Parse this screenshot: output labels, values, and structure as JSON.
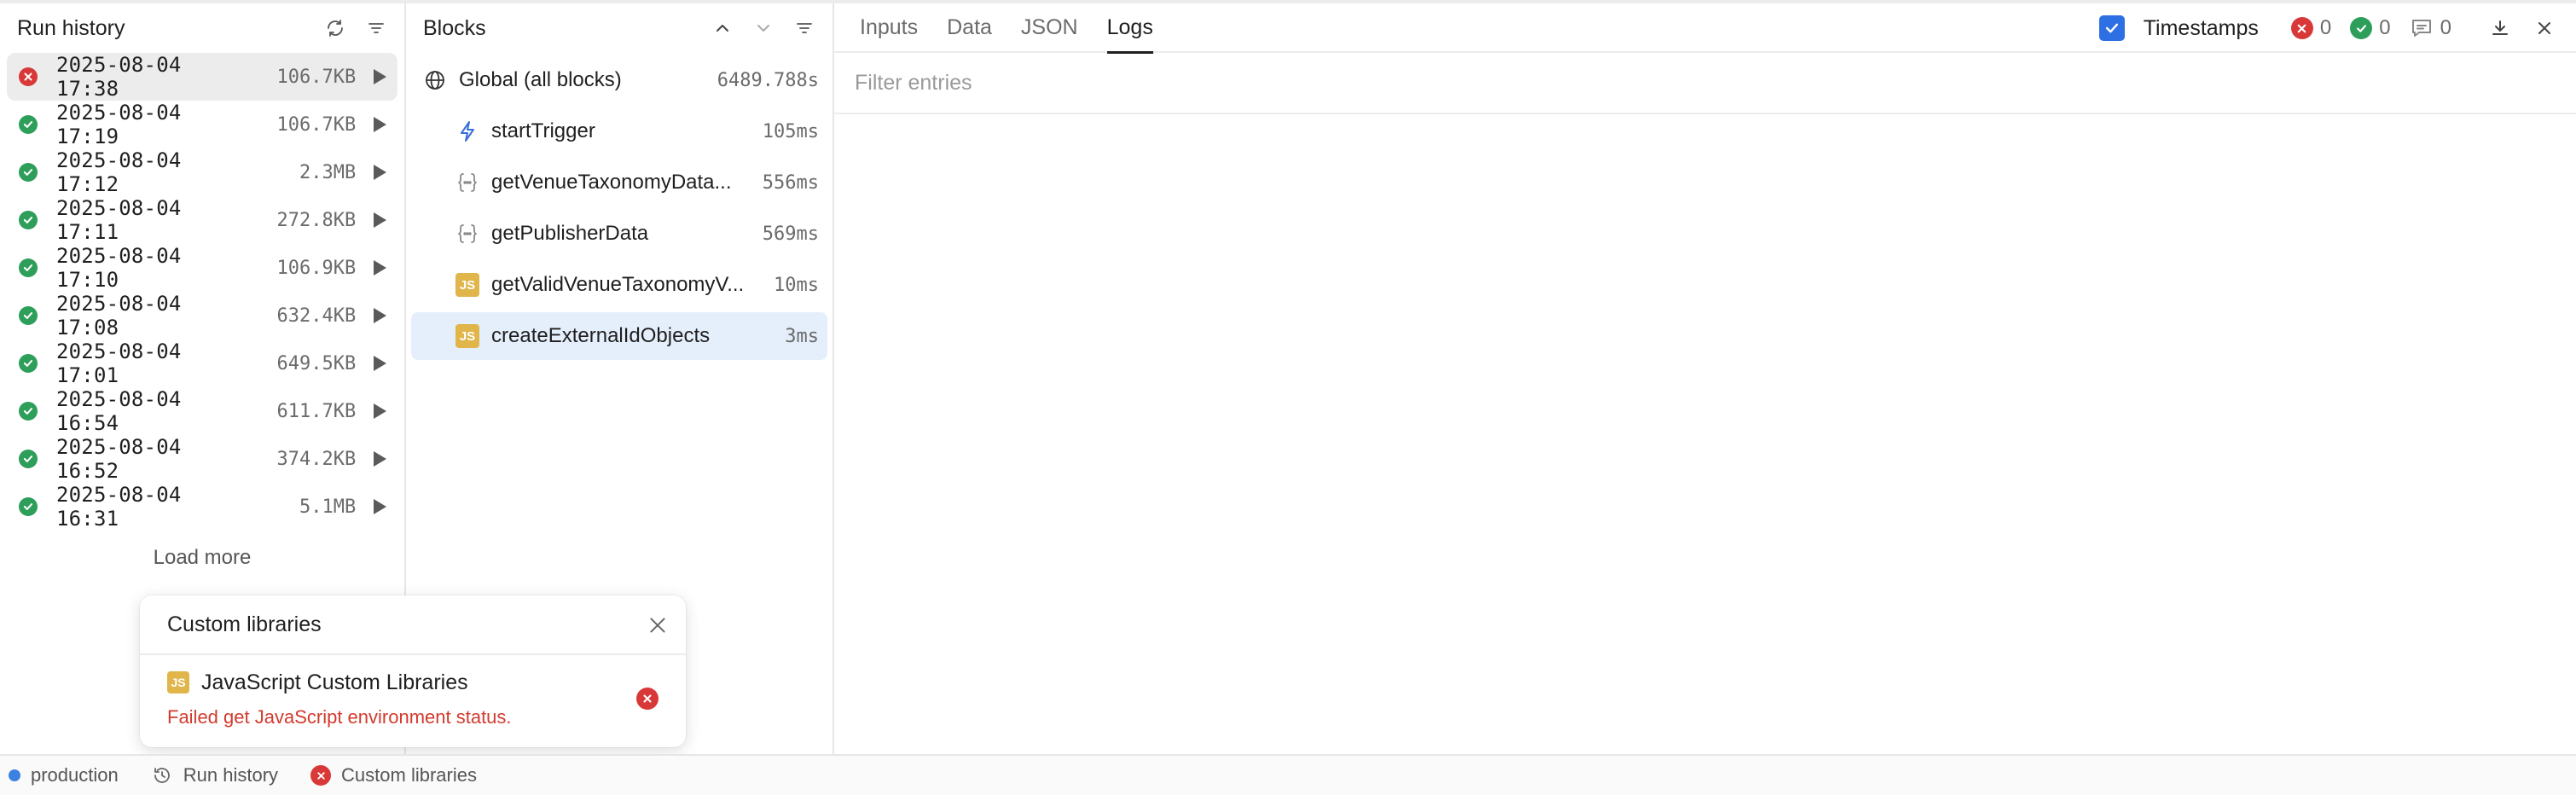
{
  "run_history": {
    "title": "Run history",
    "runs": [
      {
        "time": "2025-08-04 17:38",
        "size": "106.7KB",
        "status": "error",
        "selected": true
      },
      {
        "time": "2025-08-04 17:19",
        "size": "106.7KB",
        "status": "success"
      },
      {
        "time": "2025-08-04 17:12",
        "size": "2.3MB",
        "status": "success"
      },
      {
        "time": "2025-08-04 17:11",
        "size": "272.8KB",
        "status": "success"
      },
      {
        "time": "2025-08-04 17:10",
        "size": "106.9KB",
        "status": "success"
      },
      {
        "time": "2025-08-04 17:08",
        "size": "632.4KB",
        "status": "success"
      },
      {
        "time": "2025-08-04 17:01",
        "size": "649.5KB",
        "status": "success"
      },
      {
        "time": "2025-08-04 16:54",
        "size": "611.7KB",
        "status": "success"
      },
      {
        "time": "2025-08-04 16:52",
        "size": "374.2KB",
        "status": "success"
      },
      {
        "time": "2025-08-04 16:31",
        "size": "5.1MB",
        "status": "success"
      }
    ],
    "load_more": "Load more"
  },
  "blocks": {
    "title": "Blocks",
    "items": [
      {
        "name": "Global (all blocks)",
        "duration": "6489.788s",
        "icon": "globe-icon"
      },
      {
        "name": "startTrigger",
        "duration": "105ms",
        "icon": "lightning-icon"
      },
      {
        "name": "getVenueTaxonomyData...",
        "duration": "556ms",
        "icon": "query-braces-icon"
      },
      {
        "name": "getPublisherData",
        "duration": "569ms",
        "icon": "query-braces-icon"
      },
      {
        "name": "getValidVenueTaxonomyV...",
        "duration": "10ms",
        "icon": "js-icon"
      },
      {
        "name": "createExternalIdObjects",
        "duration": "3ms",
        "icon": "js-icon",
        "selected": true
      }
    ]
  },
  "main": {
    "tabs": [
      {
        "label": "Inputs"
      },
      {
        "label": "Data"
      },
      {
        "label": "JSON"
      },
      {
        "label": "Logs",
        "active": true
      }
    ],
    "timestamps_label": "Timestamps",
    "error_count": "0",
    "success_count": "0",
    "message_count": "0",
    "filter_placeholder": "Filter entries"
  },
  "custom_libraries_popup": {
    "title": "Custom libraries",
    "library_badge": "JS",
    "library_name": "JavaScript Custom Libraries",
    "error_message": "Failed get JavaScript environment status."
  },
  "status_bar": {
    "environment": "production",
    "run_history": "Run history",
    "custom_libraries": "Custom libraries"
  },
  "colors": {
    "success": "#2e9e5b",
    "error": "#d93838",
    "accent": "#2f6fe4",
    "js_badge": "#e0b54a",
    "selected_block": "#e5effc"
  }
}
